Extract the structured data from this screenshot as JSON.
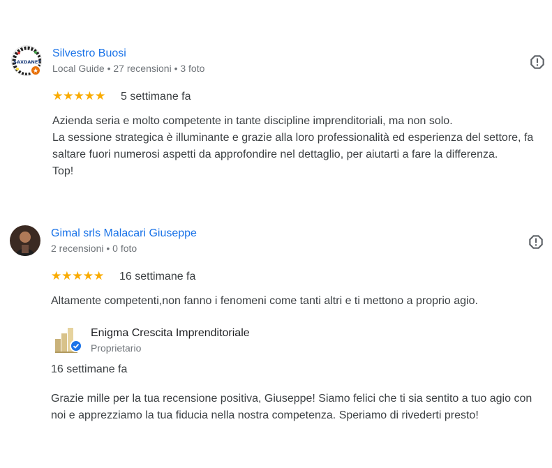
{
  "reviews": [
    {
      "author_name": "Silvestro Buosi",
      "author_meta": "Local Guide • 27 recensioni • 3 foto",
      "avatar_text": "SAXDANET",
      "rating": 5,
      "stars": "★★★★★",
      "date": "5 settimane fa",
      "text_lines": [
        "Azienda seria e molto competente in tante discipline imprenditoriali, ma non solo.",
        "La sessione strategica è illuminante e grazie alla loro professionalità ed esperienza del settore, fa saltare fuori numerosi aspetti da approfondire nel dettaglio, per aiutarti a fare la differenza.",
        "Top!"
      ],
      "icons": {
        "report": "report-icon",
        "local_guide": "local-guide-badge-icon"
      }
    },
    {
      "author_name": "Gimal srls Malacari Giuseppe",
      "author_meta": "2 recensioni • 0 foto",
      "rating": 5,
      "stars": "★★★★★",
      "date": "16 settimane fa",
      "text_lines": [
        "Altamente competenti,non fanno i fenomeni come tanti altri e ti mettono a proprio agio."
      ],
      "owner_reply": {
        "name": "Enigma Crescita Imprenditoriale",
        "role": "Proprietario",
        "date": "16 settimane fa",
        "text": "Grazie mille per la tua recensione positiva, Giuseppe! Siamo felici che ti sia sentito a tuo agio con noi e apprezziamo la tua fiducia nella nostra competenza. Speriamo di rivederti presto!"
      },
      "icons": {
        "report": "report-icon",
        "verified": "verified-icon"
      }
    }
  ],
  "colors": {
    "author_link": "#1a73e8",
    "star": "#f9ab00",
    "meta": "#70757a",
    "text": "#3c4043",
    "local_guide_badge": "#e8710a",
    "verified_badge": "#1a73e8"
  }
}
